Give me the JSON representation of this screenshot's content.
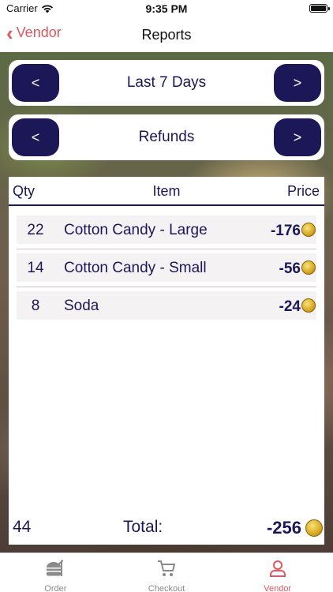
{
  "status_bar": {
    "carrier": "Carrier",
    "time": "9:35 PM"
  },
  "nav": {
    "back_label": "Vendor",
    "title": "Reports"
  },
  "range_selector": {
    "prev": "<",
    "label": "Last 7 Days",
    "next": ">"
  },
  "category_selector": {
    "prev": "<",
    "label": "Refunds",
    "next": ">"
  },
  "table": {
    "headers": {
      "qty": "Qty",
      "item": "Item",
      "price": "Price"
    },
    "rows": [
      {
        "qty": "22",
        "item": "Cotton Candy - Large",
        "price": "-176"
      },
      {
        "qty": "14",
        "item": "Cotton Candy - Small",
        "price": "-56"
      },
      {
        "qty": "8",
        "item": "Soda",
        "price": "-24"
      }
    ]
  },
  "footer": {
    "total_qty": "44",
    "total_label": "Total:",
    "total_price": "-256"
  },
  "tabs": [
    {
      "label": "Order",
      "icon": "food-icon",
      "active": false
    },
    {
      "label": "Checkout",
      "icon": "cart-icon",
      "active": false
    },
    {
      "label": "Vendor",
      "icon": "person-icon",
      "active": true
    }
  ],
  "colors": {
    "accent": "#e0575f",
    "navy": "#1c1757"
  }
}
